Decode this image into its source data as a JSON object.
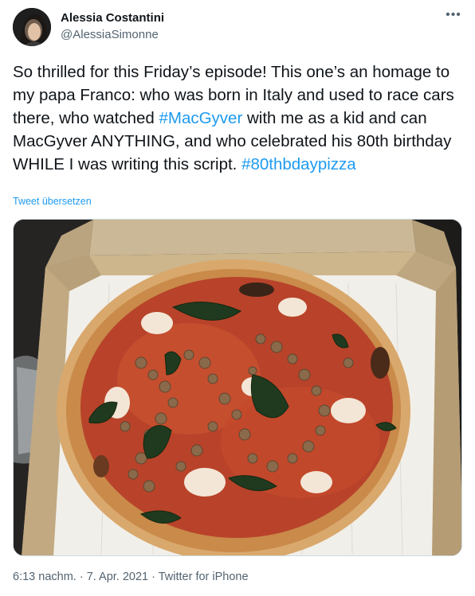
{
  "author": {
    "name": "Alessia Costantini",
    "handle": "@AlessiaSimonne"
  },
  "more_icon": "ellipsis-icon",
  "tweet": {
    "segments": [
      {
        "text": "So thrilled for this Friday’s episode! This one’s an homage to my papa Franco: who was born in Italy and used to race cars there, who watched ",
        "link": false
      },
      {
        "text": "#MacGyver",
        "link": true
      },
      {
        "text": " with me as a kid and can MacGyver ANYTHING, and who celebrated his 80th birthday WHILE I was writing this script. ",
        "link": false
      },
      {
        "text": "#80thbdaypizza",
        "link": true
      }
    ],
    "translate_label": "Tweet übersetzen"
  },
  "media": {
    "description_icon": "pizza-photo"
  },
  "footer": {
    "time": "6:13 nachm.",
    "separator": " · ",
    "date": "7. Apr. 2021",
    "source": "Twitter for iPhone"
  },
  "colors": {
    "link": "#1d9bf0",
    "secondary": "#536471",
    "text": "#0f1419"
  }
}
